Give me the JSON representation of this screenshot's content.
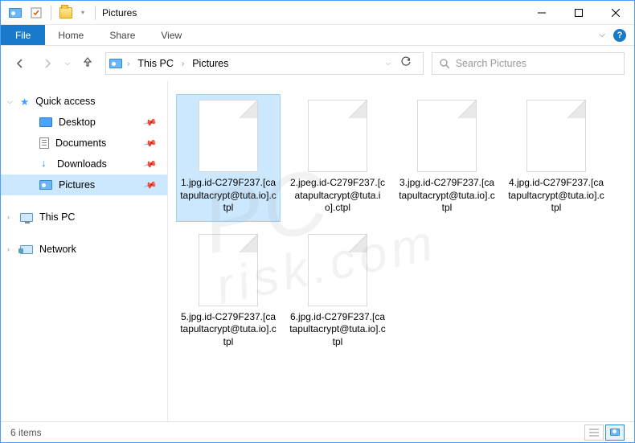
{
  "title": "Pictures",
  "ribbon": {
    "file": "File",
    "home": "Home",
    "share": "Share",
    "view": "View"
  },
  "breadcrumb": {
    "root": "This PC",
    "current": "Pictures"
  },
  "search": {
    "placeholder": "Search Pictures"
  },
  "sidebar": {
    "quick_access": "Quick access",
    "desktop": "Desktop",
    "documents": "Documents",
    "downloads": "Downloads",
    "pictures": "Pictures",
    "this_pc": "This PC",
    "network": "Network"
  },
  "files": [
    {
      "name": "1.jpg.id-C279F237.[catapultacrypt@tuta.io].ctpl"
    },
    {
      "name": "2.jpeg.id-C279F237.[catapultacrypt@tuta.io].ctpl"
    },
    {
      "name": "3.jpg.id-C279F237.[catapultacrypt@tuta.io].ctpl"
    },
    {
      "name": "4.jpg.id-C279F237.[catapultacrypt@tuta.io].ctpl"
    },
    {
      "name": "5.jpg.id-C279F237.[catapultacrypt@tuta.io].ctpl"
    },
    {
      "name": "6.jpg.id-C279F237.[catapultacrypt@tuta.io].ctpl"
    }
  ],
  "status": {
    "count": "6 items"
  },
  "watermark": {
    "line1": "PC",
    "line2": "risk.com"
  }
}
